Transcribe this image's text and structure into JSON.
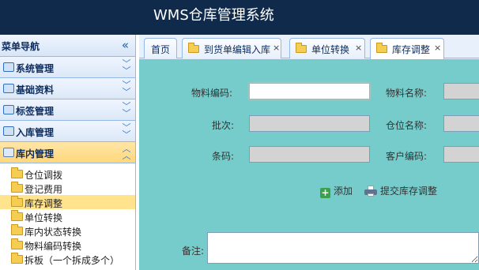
{
  "app": {
    "title": "WMS仓库管理系统"
  },
  "sidebar": {
    "header": "菜单导航",
    "collapse_icon": "double-chevron-left-icon",
    "sections": [
      {
        "label": "系统管理",
        "expanded": false
      },
      {
        "label": "基础资料",
        "expanded": false
      },
      {
        "label": "标签管理",
        "expanded": false
      },
      {
        "label": "入库管理",
        "expanded": false
      },
      {
        "label": "库内管理",
        "expanded": true
      }
    ],
    "items": [
      {
        "label": "仓位调拨",
        "selected": false
      },
      {
        "label": "登记费用",
        "selected": false
      },
      {
        "label": "库存调整",
        "selected": true
      },
      {
        "label": "单位转换",
        "selected": false
      },
      {
        "label": "库内状态转换",
        "selected": false
      },
      {
        "label": "物料编码转换",
        "selected": false
      },
      {
        "label": "拆板（一个拆成多个）",
        "selected": false
      }
    ]
  },
  "tabs": [
    {
      "label": "首页",
      "closable": false,
      "active": false
    },
    {
      "label": "到货单编辑入库",
      "closable": true,
      "active": false
    },
    {
      "label": "单位转换",
      "closable": true,
      "active": false
    },
    {
      "label": "库存调整",
      "closable": true,
      "active": true
    }
  ],
  "form": {
    "material_code_label": "物料编码:",
    "material_name_label": "物料名称:",
    "batch_label": "批次:",
    "location_label": "仓位名称:",
    "barcode_label": "条码:",
    "customer_code_label": "客户编码:",
    "remark_label": "备注:",
    "material_code_value": "",
    "material_name_value": "",
    "batch_value": "",
    "location_value": "",
    "barcode_value": "",
    "customer_code_value": ""
  },
  "actions": {
    "add_label": "添加",
    "submit_label": "提交库存调整"
  },
  "colors": {
    "topbar": "#0f2a4a",
    "panel": "#76cccb",
    "accent_active": "#ffd77c",
    "selected_item": "#ffe48d"
  }
}
